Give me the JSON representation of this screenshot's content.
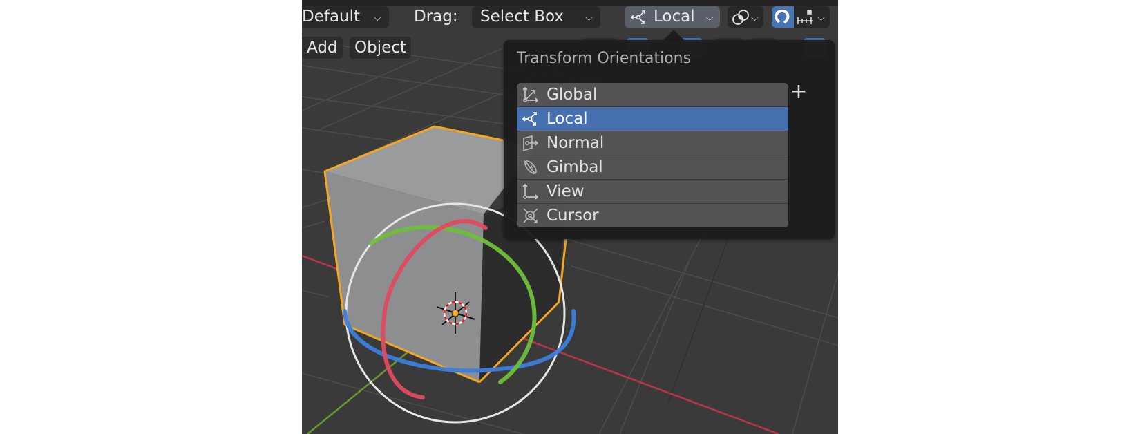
{
  "header": {
    "orientation_preset": "Default",
    "drag_label": "Drag:",
    "drag_value": "Select Box",
    "transform_orientation": "Local",
    "pivot_icon": "pivot-point-icon",
    "snap_icon": "magnet-icon",
    "snap_increment_icon": "snap-increment-icon",
    "chevron": "⌄"
  },
  "menu": {
    "add_label": "Add",
    "object_label": "Object"
  },
  "popup": {
    "title": "Transform Orientations",
    "add_label": "+",
    "items": [
      {
        "label": "Global",
        "icon": "global-orientation-icon",
        "active": false
      },
      {
        "label": "Local",
        "icon": "local-orientation-icon",
        "active": true
      },
      {
        "label": "Normal",
        "icon": "normal-orientation-icon",
        "active": false
      },
      {
        "label": "Gimbal",
        "icon": "gimbal-orientation-icon",
        "active": false
      },
      {
        "label": "View",
        "icon": "view-orientation-icon",
        "active": false
      },
      {
        "label": "Cursor",
        "icon": "cursor-orientation-icon",
        "active": false
      }
    ]
  },
  "colors": {
    "accent": "#4772b3",
    "selection_outline": "#f5a623",
    "axis_x": "#d6374e",
    "axis_y": "#6fa530",
    "axis_z": "#3b7ddd",
    "viewport_bg": "#3a3a3a"
  }
}
